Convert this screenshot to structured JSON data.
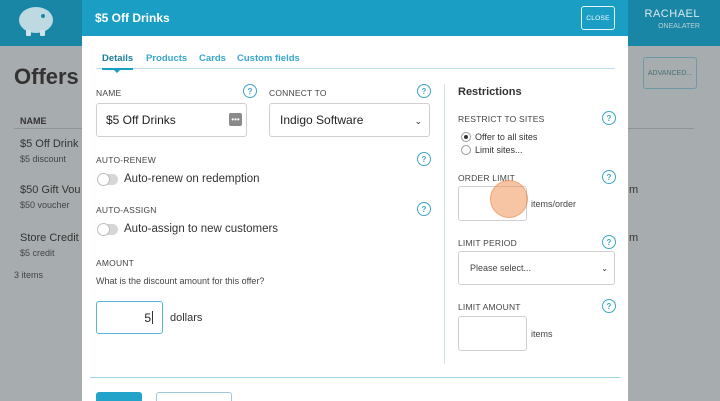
{
  "background": {
    "user_name": "RACHAEL",
    "user_company": "ONEALATER",
    "page_title": "Offers",
    "advanced_label": "ADVANCED...",
    "column_name": "NAME",
    "rows": [
      {
        "name": "$5 Off Drink",
        "sub": "$5 discount",
        "right": ""
      },
      {
        "name": "$50 Gift Vou",
        "sub": "$50 voucher",
        "right": "m"
      },
      {
        "name": "Store Credit",
        "sub": "$5 credit",
        "right": "m"
      }
    ],
    "items_count": "3 items"
  },
  "modal": {
    "title": "$5 Off Drinks",
    "close_label": "CLOSE",
    "tabs": [
      "Details",
      "Products",
      "Cards",
      "Custom fields"
    ],
    "name_label": "NAME",
    "name_value": "$5 Off Drinks",
    "kebab_glyph": "•••",
    "connect_label": "CONNECT TO",
    "connect_value": "Indigo Software",
    "help_glyph": "?",
    "chevron_glyph": "⌄",
    "auto_renew_label": "AUTO-RENEW",
    "auto_renew_text": "Auto-renew on redemption",
    "auto_renew_on": false,
    "auto_assign_label": "AUTO-ASSIGN",
    "auto_assign_text": "Auto-assign to new customers",
    "auto_assign_on": false,
    "amount_label": "AMOUNT",
    "amount_question": "What is the discount amount for this offer?",
    "amount_value": "5",
    "amount_unit": "dollars",
    "restrictions": {
      "title": "Restrictions",
      "sites_label": "RESTRICT TO SITES",
      "offer_all": "Offer to all sites",
      "limit_sites": "Limit sites...",
      "selected_option": "Offer to all sites",
      "order_limit_label": "ORDER LIMIT",
      "order_limit_unit": "items/order",
      "limit_period_label": "LIMIT PERIOD",
      "limit_period_placeholder": "Please select...",
      "limit_amount_label": "LIMIT AMOUNT",
      "limit_amount_unit": "items"
    }
  },
  "colors": {
    "header": "#1a86a6",
    "modal_header": "#1a9ec4",
    "accent": "#38a6cc",
    "cursor_halo": "#f2965a"
  }
}
